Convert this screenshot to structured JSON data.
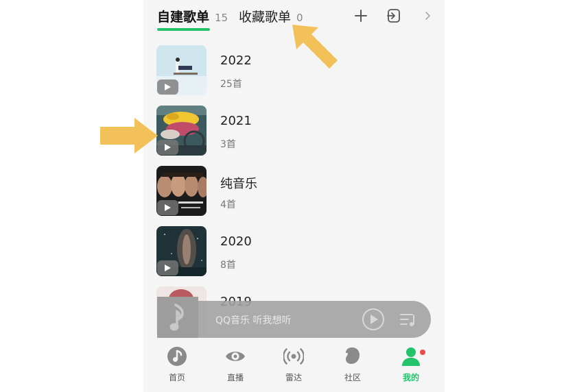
{
  "tabs": {
    "self_built": {
      "label": "自建歌单",
      "count": "15"
    },
    "collected": {
      "label": "收藏歌单",
      "count": "0"
    }
  },
  "header_icons": [
    "plus-icon",
    "import-icon",
    "chevron-right-icon"
  ],
  "playlists": [
    {
      "name": "2022",
      "count": "25首"
    },
    {
      "name": "2021",
      "count": "3首"
    },
    {
      "name": "纯音乐",
      "count": "4首"
    },
    {
      "name": "2020",
      "count": "8首"
    },
    {
      "name": "2019",
      "count": ""
    }
  ],
  "mini_player": {
    "text": "QQ音乐 听我想听"
  },
  "bottom_nav": [
    {
      "label": "首页",
      "icon": "home-note-icon"
    },
    {
      "label": "直播",
      "icon": "eye-icon"
    },
    {
      "label": "雷达",
      "icon": "radar-icon"
    },
    {
      "label": "社区",
      "icon": "community-icon"
    },
    {
      "label": "我的",
      "icon": "profile-icon",
      "active": true
    }
  ],
  "colors": {
    "accent": "#22c36b",
    "background": "#f5f5f5",
    "annotation_arrow": "#f3c15a",
    "notification_dot": "#ea4a4a"
  }
}
